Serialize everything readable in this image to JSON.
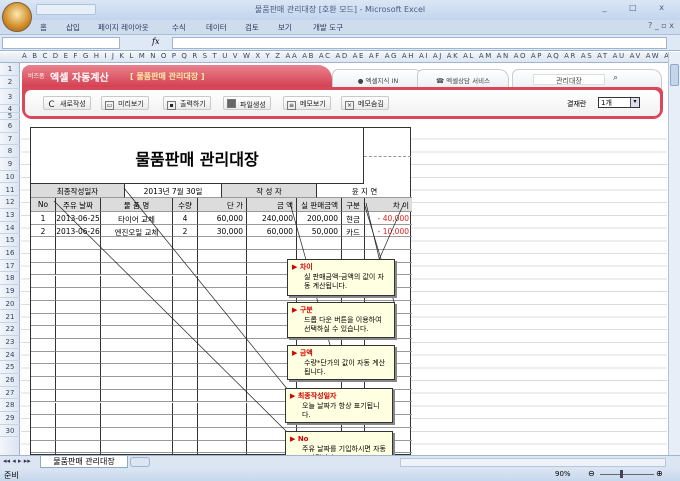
{
  "window": {
    "title": "물품판매 관리대장 [호환 모드] - Microsoft Excel",
    "controls": [
      "_",
      "□",
      "X"
    ]
  },
  "ribbon_tabs": [
    "홈",
    "삽입",
    "페이지 레이아웃",
    "수식",
    "데이터",
    "검토",
    "보기",
    "개발 도구"
  ],
  "formula": {
    "fx": "fx",
    "value": ""
  },
  "columns": "A B C D E F G H I J K L M N O P Q R S T U V W X Y Z AA AB AC AD AE AF AG AH AI AJ AK AL AM AN AO AP AQ AR AS AT AU AV AW AX AY AZ BB BC BD",
  "rows": [
    "1",
    "2",
    "3",
    "4",
    "5",
    "6",
    "7",
    "8",
    "9",
    "10",
    "11",
    "12",
    "13",
    "14",
    "15",
    "16",
    "17",
    "18",
    "19",
    "20",
    "21",
    "22",
    "23",
    "24",
    "25",
    "26",
    "27",
    "28",
    "29",
    "30"
  ],
  "banner": {
    "brand": "비즈폼",
    "app": "엑셀 자동계산",
    "doc": "[ 물품판매 관리대장 ]",
    "tab1": "엑셀지식 IN",
    "tab2": "엑셀상담 서비스",
    "search_value": "관리대장",
    "buttons": [
      "새로작성",
      "미리보기",
      "출력하기",
      "파일생성",
      "메모보기",
      "메모숨김"
    ],
    "approval_label": "결재란",
    "approval_value": "1개"
  },
  "form": {
    "title": "물품판매 관리대장",
    "date_label": "최종작성일자",
    "date_value": "2013년 7월 30일",
    "author_label": "작 성 자",
    "author_value": "윤 지 연",
    "headers": [
      "No",
      "주유 날짜",
      "물 품 명",
      "수량",
      "단  가",
      "금  액",
      "실 판매금액",
      "구분",
      "차  이"
    ],
    "rows": [
      [
        "1",
        "2013-06-25",
        "타이어 교체",
        "4",
        "60,000",
        "240,000",
        "200,000",
        "현금",
        "- 40,000"
      ],
      [
        "2",
        "2013-06-26",
        "엔진오일 교체",
        "2",
        "30,000",
        "60,000",
        "50,000",
        "카드",
        "- 10,000"
      ]
    ]
  },
  "memos": [
    {
      "title": "차이",
      "body": "실 판매금액-금액의 값이 자동 계산됩니다."
    },
    {
      "title": "구분",
      "body": "드롭 다운 버튼을 이용하여 선택하실 수 있습니다."
    },
    {
      "title": "금액",
      "body": "수량*단가의 값이 자동 계산됩니다."
    },
    {
      "title": "최종작성일자",
      "body": "오늘 날짜가 항상 표기됩니다."
    },
    {
      "title": "No",
      "body": "주유 날짜를 기입하시면 자동 표기됩니다."
    }
  ],
  "sheet_tab": "물품판매 관리대장",
  "status": {
    "ready": "준비",
    "zoom": "90%"
  },
  "colors": {
    "banner_red": "#d8475a",
    "negative": "#e02020",
    "memo_title": "#d00000"
  }
}
